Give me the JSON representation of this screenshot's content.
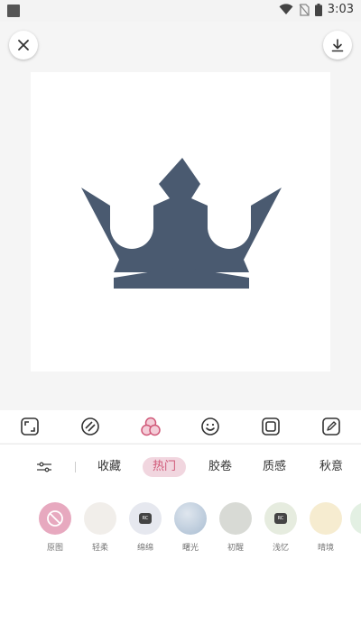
{
  "status_bar": {
    "time": "3:03"
  },
  "header": {
    "close_icon": "close-icon",
    "download_icon": "download-icon"
  },
  "image": {
    "subject": "crown-logo",
    "color": "#4a5a70"
  },
  "toolbar": {
    "items": [
      {
        "name": "crop-icon"
      },
      {
        "name": "stripes-icon"
      },
      {
        "name": "filter-circles-icon",
        "active_color": "#d05878"
      },
      {
        "name": "smiley-icon"
      },
      {
        "name": "frame-icon"
      },
      {
        "name": "pencil-icon"
      }
    ]
  },
  "categories": {
    "adjust_icon": "sliders-icon",
    "items": [
      {
        "label": "收藏"
      },
      {
        "label": "热门",
        "active": true
      },
      {
        "label": "胶卷"
      },
      {
        "label": "质感"
      },
      {
        "label": "秋意"
      }
    ]
  },
  "filters": [
    {
      "label": "原图",
      "color": "#e7a9bf",
      "icon": "none-icon"
    },
    {
      "label": "轻柔",
      "color": "#f1eeea"
    },
    {
      "label": "绵绵",
      "color": "#e6e8ef",
      "badge": true
    },
    {
      "label": "曙光",
      "color": "#b9c8d8"
    },
    {
      "label": "初醒",
      "color": "#d8dad5"
    },
    {
      "label": "浅忆",
      "color": "#e6ecdf",
      "badge": true
    },
    {
      "label": "晴境",
      "color": "#f6ecd0"
    }
  ],
  "accent": "#d05878"
}
